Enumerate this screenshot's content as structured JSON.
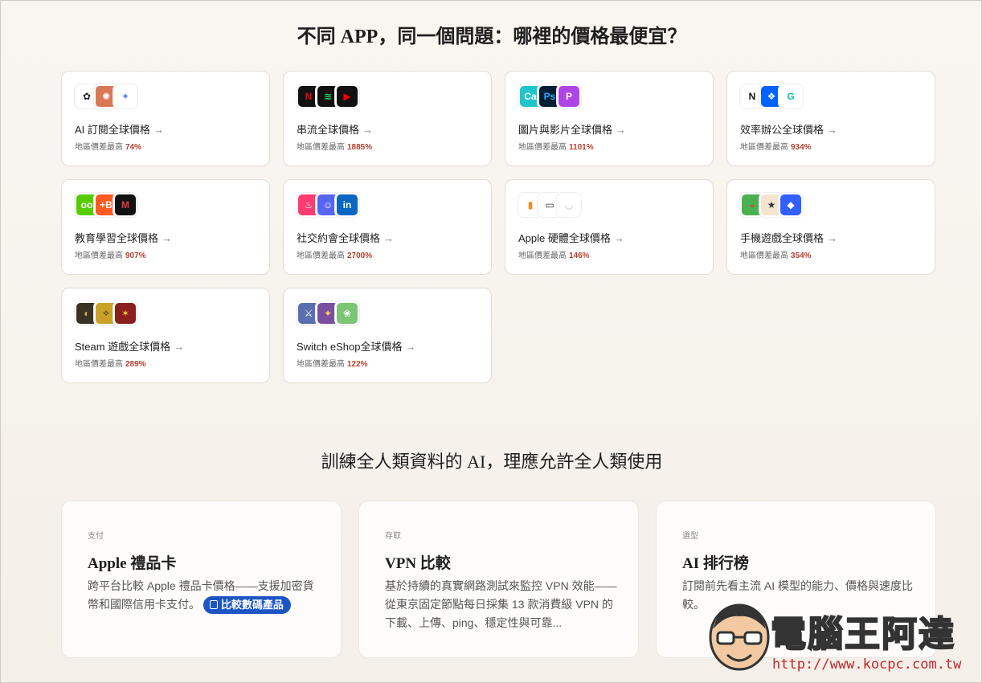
{
  "section1_title": "不同 APP，同一個問題：哪裡的價格最便宜？",
  "sub_prefix": "地區價差最高",
  "arrow": "→",
  "cards": [
    {
      "title": "AI 訂閱全球價格",
      "pct": "74%",
      "icons": [
        {
          "t": "✿",
          "bg": "#ffffff",
          "fg": "#222"
        },
        {
          "t": "✺",
          "bg": "#d97757",
          "fg": "#fff"
        },
        {
          "t": "✦",
          "bg": "#ffffff",
          "fg": "#4a8af4"
        }
      ]
    },
    {
      "title": "串流全球價格",
      "pct": "1885%",
      "icons": [
        {
          "t": "N",
          "bg": "#111",
          "fg": "#e50914"
        },
        {
          "t": "≋",
          "bg": "#111",
          "fg": "#1ed760"
        },
        {
          "t": "▶",
          "bg": "#111",
          "fg": "#ff0000"
        }
      ]
    },
    {
      "title": "圖片與影片全球價格",
      "pct": "1101%",
      "icons": [
        {
          "t": "Ca",
          "bg": "#20c4cb",
          "fg": "#fff"
        },
        {
          "t": "Ps",
          "bg": "#001e36",
          "fg": "#31a8ff"
        },
        {
          "t": "P",
          "bg": "#b045e6",
          "fg": "#fff"
        }
      ]
    },
    {
      "title": "效率辦公全球價格",
      "pct": "934%",
      "icons": [
        {
          "t": "N",
          "bg": "#ffffff",
          "fg": "#111"
        },
        {
          "t": "❖",
          "bg": "#0061fe",
          "fg": "#fff"
        },
        {
          "t": "G",
          "bg": "#ffffff",
          "fg": "#15c39a"
        }
      ]
    },
    {
      "title": "教育學習全球價格",
      "pct": "907%",
      "icons": [
        {
          "t": "oo",
          "bg": "#58cc02",
          "fg": "#fff"
        },
        {
          "t": "+B",
          "bg": "#ff5a1f",
          "fg": "#fff"
        },
        {
          "t": "M",
          "bg": "#111",
          "fg": "#e03a3e"
        }
      ]
    },
    {
      "title": "社交約會全球價格",
      "pct": "2700%",
      "icons": [
        {
          "t": "♨",
          "bg": "#fe3c72",
          "fg": "#fff"
        },
        {
          "t": "☺",
          "bg": "#5865f2",
          "fg": "#fff"
        },
        {
          "t": "in",
          "bg": "#0a66c2",
          "fg": "#fff"
        }
      ]
    },
    {
      "title": "Apple 硬體全球價格",
      "pct": "146%",
      "icons": [
        {
          "t": "▮",
          "bg": "#ffffff",
          "fg": "#f08a24"
        },
        {
          "t": "▭",
          "bg": "#ffffff",
          "fg": "#333"
        },
        {
          "t": "◡",
          "bg": "#ffffff",
          "fg": "#bbb"
        }
      ]
    },
    {
      "title": "手機遊戲全球價格",
      "pct": "354%",
      "icons": [
        {
          "t": "◒",
          "bg": "#4caf50",
          "fg": "#e53935"
        },
        {
          "t": "★",
          "bg": "#f3e5d0",
          "fg": "#333"
        },
        {
          "t": "◆",
          "bg": "#335fff",
          "fg": "#fff"
        }
      ]
    },
    {
      "title": "Steam 遊戲全球價格",
      "pct": "289%",
      "icons": [
        {
          "t": "◐",
          "bg": "#3a3324",
          "fg": "#e0b04a"
        },
        {
          "t": "✧",
          "bg": "#c9a227",
          "fg": "#111"
        },
        {
          "t": "✶",
          "bg": "#8b1e1e",
          "fg": "#f4c542"
        }
      ]
    },
    {
      "title": "Switch eShop全球價格",
      "pct": "122%",
      "icons": [
        {
          "t": "⚔",
          "bg": "#5a6fb0",
          "fg": "#fff"
        },
        {
          "t": "✦",
          "bg": "#7b4fa0",
          "fg": "#ffd54f"
        },
        {
          "t": "❀",
          "bg": "#7cc576",
          "fg": "#fff"
        }
      ]
    }
  ],
  "section2_title": "訓練全人類資料的 AI，理應允許全人類使用",
  "bottom_cards": [
    {
      "tag": "支付",
      "title": "Apple 禮品卡",
      "desc": "跨平台比較 Apple 禮品卡價格——支援加密貨幣和國際信用卡支付。",
      "pill": "比較數碼產品"
    },
    {
      "tag": "存取",
      "title": "VPN 比較",
      "desc": "基於持續的真實網路測試來監控 VPN 效能——從東京固定節點每日採集 13 款消費級 VPN 的下載、上傳、ping、穩定性與可靠..."
    },
    {
      "tag": "選型",
      "title": "AI 排行榜",
      "desc": "訂閱前先看主流 AI 模型的能力、價格與速度比較。"
    }
  ],
  "watermark": {
    "name": "電腦王阿達",
    "url": "http://www.kocpc.com.tw"
  }
}
